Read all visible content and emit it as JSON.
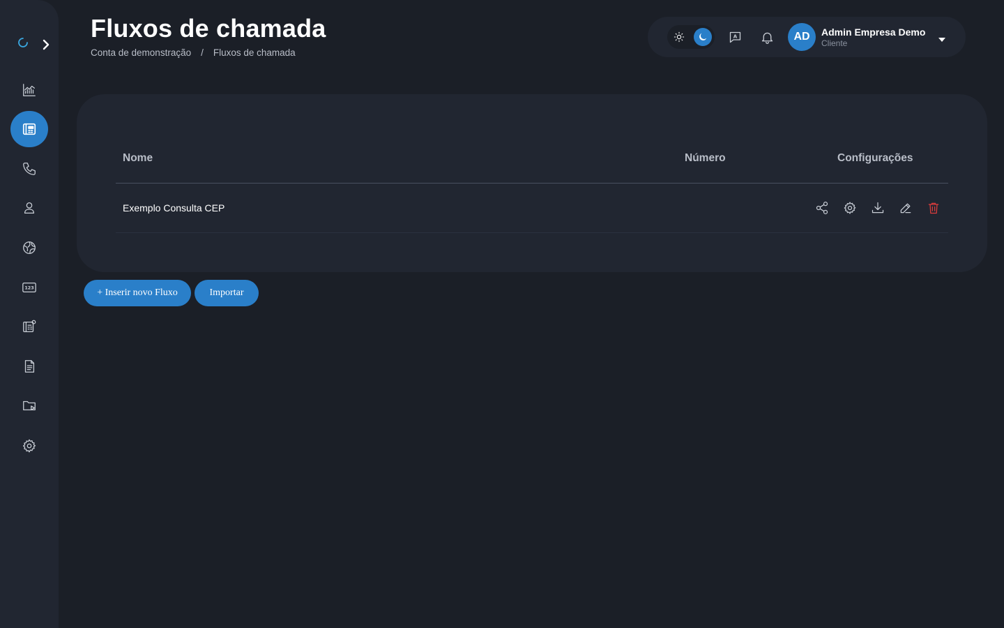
{
  "header": {
    "title": "Fluxos de chamada",
    "breadcrumb": [
      "Conta de demonstração",
      "Fluxos de chamada"
    ],
    "breadcrumb_separator": "/"
  },
  "user": {
    "initials": "AD",
    "name": "Admin Empresa Demo",
    "role": "Cliente"
  },
  "sidebar": {
    "items": [
      {
        "name": "dashboard",
        "icon": "chart-icon",
        "active": false
      },
      {
        "name": "call-flows",
        "icon": "flow-panel-icon",
        "active": true
      },
      {
        "name": "calls",
        "icon": "phone-icon",
        "active": false
      },
      {
        "name": "users",
        "icon": "user-icon",
        "active": false
      },
      {
        "name": "network",
        "icon": "globe-icon",
        "active": false
      },
      {
        "name": "numbers",
        "icon": "numbers-123-icon",
        "active": false
      },
      {
        "name": "flow-settings",
        "icon": "panel-settings-icon",
        "active": false
      },
      {
        "name": "reports",
        "icon": "document-icon",
        "active": false
      },
      {
        "name": "media",
        "icon": "folder-play-icon",
        "active": false
      },
      {
        "name": "settings",
        "icon": "gear-icon",
        "active": false
      }
    ]
  },
  "table": {
    "columns": [
      "Nome",
      "Número",
      "Configurações"
    ],
    "rows": [
      {
        "name": "Exemplo Consulta CEP",
        "number": "",
        "actions": [
          "share-icon",
          "gear-icon",
          "download-icon",
          "edit-icon",
          "trash-icon"
        ]
      }
    ]
  },
  "buttons": {
    "new_flow": "+ Inserir novo Fluxo",
    "import": "Importar"
  },
  "colors": {
    "accent": "#2a7fc9",
    "background": "#1b1f27",
    "panel": "#212631",
    "danger": "#e03c3c"
  }
}
